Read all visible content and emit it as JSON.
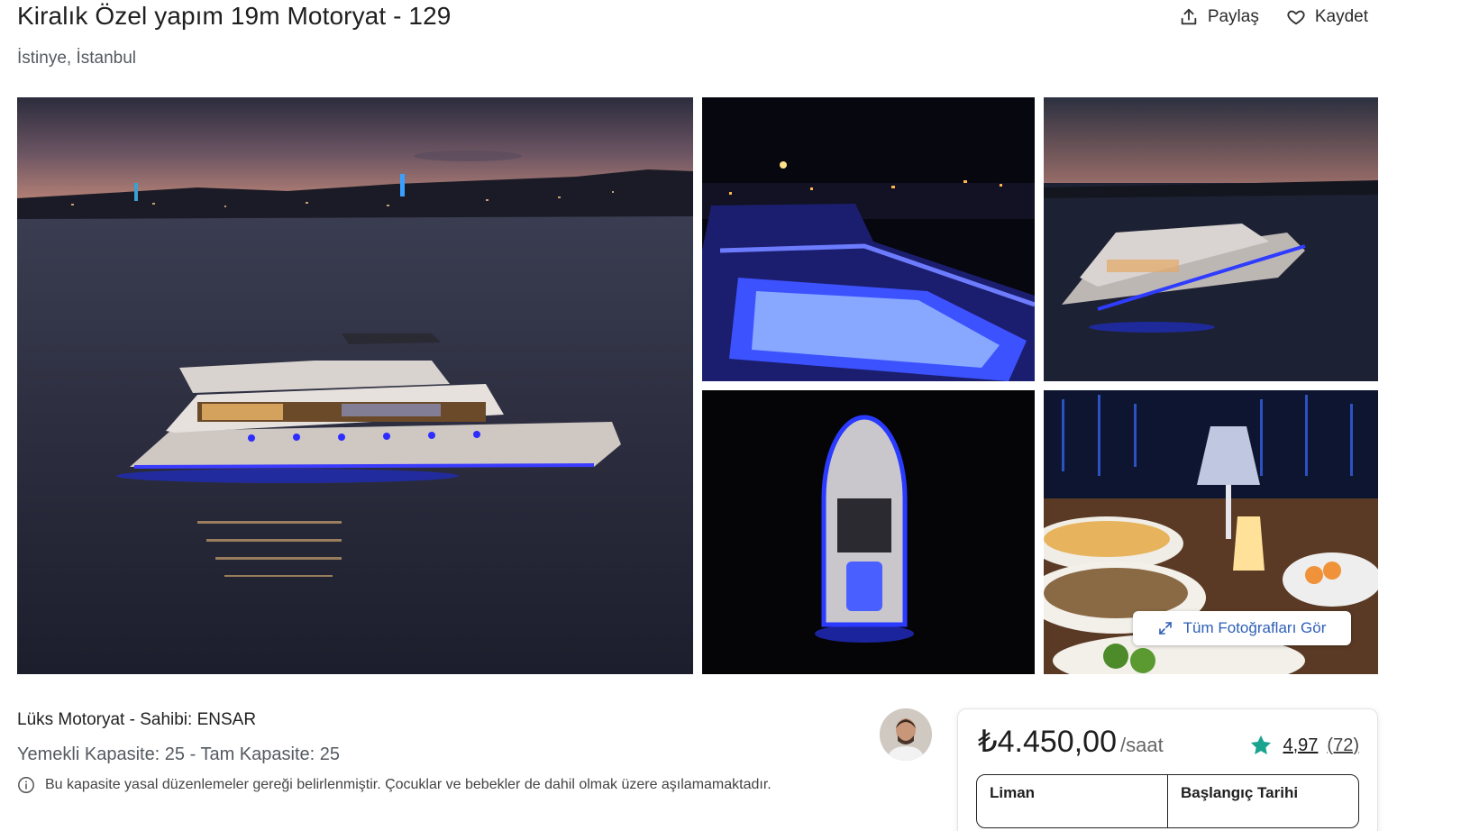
{
  "header": {
    "title": "Kiralık Özel yapım 19m Motoryat - 129",
    "location": "İstinye, İstanbul",
    "share_label": "Paylaş",
    "save_label": "Kaydet",
    "share_icon": "share-icon",
    "save_icon": "heart-icon"
  },
  "gallery": {
    "all_photos_label": "Tüm Fotoğrafları Gör",
    "all_photos_icon": "expand-icon",
    "photo_count": 5
  },
  "listing": {
    "subtitle": "Lüks Motoryat - Sahibi: ENSAR",
    "capacity": "Yemekli Kapasite: 25 - Tam Kapasite: 25",
    "notice": "Bu kapasite yasal düzenlemeler gereği belirlenmiştir. Çocuklar ve bebekler de dahil olmak üzere aşılamamaktadır.",
    "notice_icon": "info-icon"
  },
  "booking": {
    "price": "₺4.450,00",
    "unit": "/saat",
    "rating": "4,97",
    "review_count": "(72)",
    "rating_icon": "star-icon",
    "field_port": "Liman",
    "field_start_date": "Başlangıç Tarihi"
  },
  "colors": {
    "accent_star": "#1aa38f",
    "link_blue": "#2e5fb8",
    "night_blue": "#1b2bff"
  }
}
